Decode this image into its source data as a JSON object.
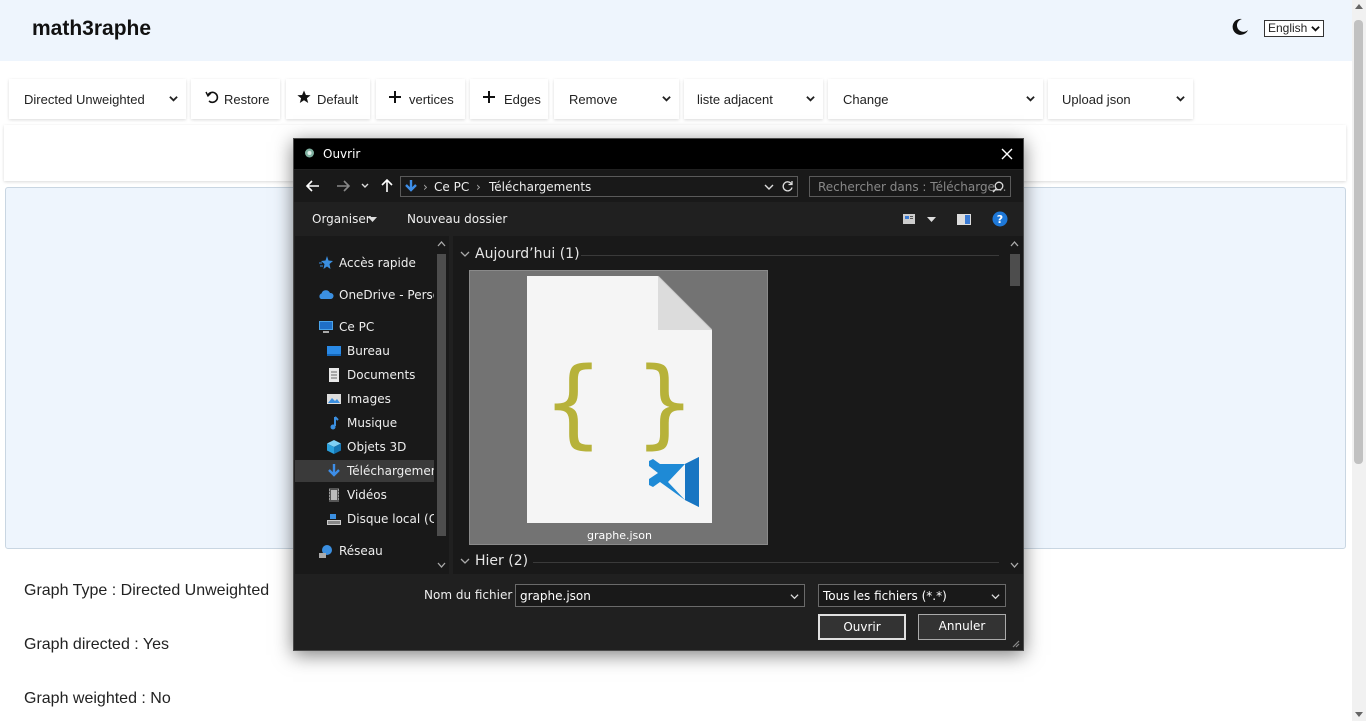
{
  "app": {
    "title": "math3raphe",
    "language": "English"
  },
  "toolbar": {
    "graph_type": "Directed Unweighted",
    "restore": "Restore",
    "default": "Default",
    "vertices": "vertices",
    "edges": "Edges",
    "remove": "Remove",
    "adjacency": "liste adjacent",
    "change": "Change",
    "upload": "Upload json"
  },
  "info": {
    "graph_type": "Graph Type : Directed Unweighted",
    "directed": "Graph directed : Yes",
    "weighted": "Graph weighted : No"
  },
  "dialog": {
    "title": "Ouvrir",
    "breadcrumb": [
      "Ce PC",
      "Téléchargements"
    ],
    "search_placeholder": "Rechercher dans : Télécharge...",
    "organize": "Organiser",
    "new_folder": "Nouveau dossier",
    "nav_items": [
      {
        "label": "Accès rapide",
        "icon": "star-icon"
      },
      {
        "label": "OneDrive - Person",
        "icon": "cloud-icon"
      },
      {
        "label": "Ce PC",
        "icon": "computer-icon"
      },
      {
        "label": "Bureau",
        "icon": "desktop-icon"
      },
      {
        "label": "Documents",
        "icon": "document-icon"
      },
      {
        "label": "Images",
        "icon": "image-icon"
      },
      {
        "label": "Musique",
        "icon": "music-icon"
      },
      {
        "label": "Objets 3D",
        "icon": "cube-icon"
      },
      {
        "label": "Téléchargements",
        "icon": "download-icon"
      },
      {
        "label": "Vidéos",
        "icon": "video-icon"
      },
      {
        "label": "Disque local (C:)",
        "icon": "disk-icon"
      },
      {
        "label": "Réseau",
        "icon": "network-icon"
      }
    ],
    "groups": [
      {
        "label": "Aujourd’hui (1)"
      },
      {
        "label": "Hier (2)"
      }
    ],
    "file": {
      "name": "graphe.json"
    },
    "filename_label": "Nom du fichier :",
    "filename_value": "graphe.json",
    "filetype": "Tous les fichiers (*.*)",
    "open": "Ouvrir",
    "cancel": "Annuler"
  }
}
